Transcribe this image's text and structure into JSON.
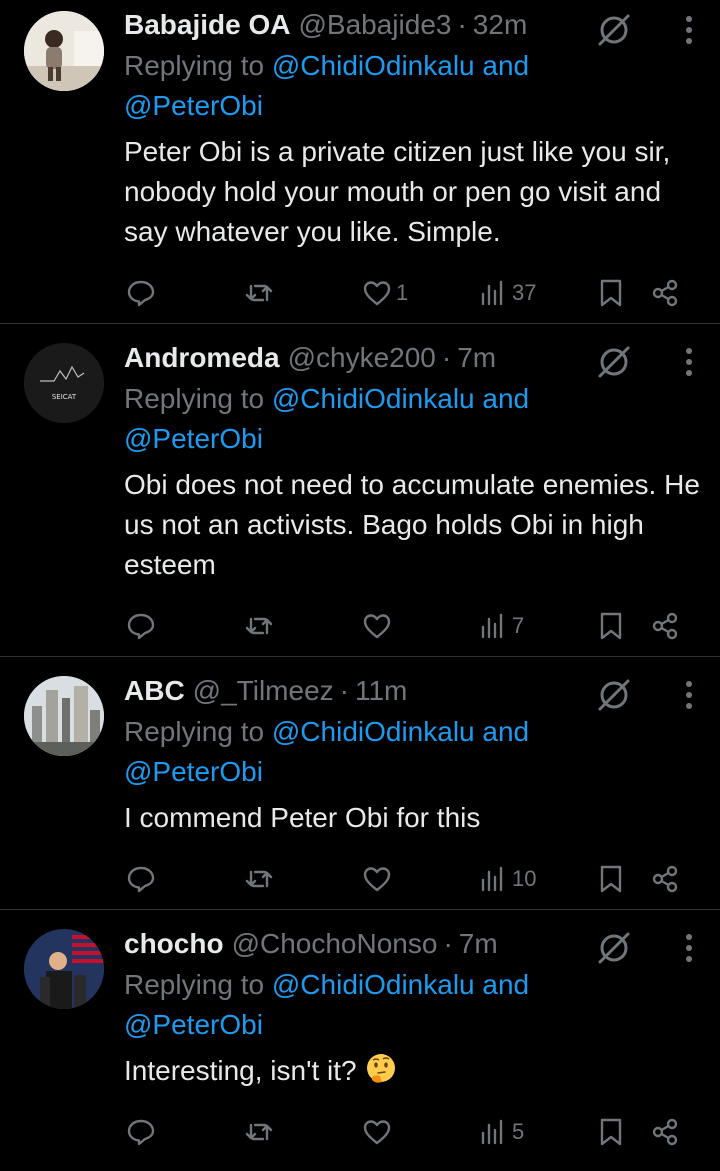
{
  "tweets": [
    {
      "name": "Babajide OA",
      "handle": "@Babajide3",
      "time": "32m",
      "replying_prefix": "Replying to ",
      "replying_mention1": "@ChidiOdinkalu",
      "replying_and": " and",
      "replying_mention2": "@PeterObi",
      "text": "Peter Obi is a private citizen just like you sir, nobody hold your mouth or pen go visit and say whatever you like. Simple.",
      "likes": "1",
      "views": "37",
      "avatar": "photo-child-avatar"
    },
    {
      "name": "Andromeda",
      "handle": "@chyke200",
      "time": "7m",
      "replying_prefix": "Replying to ",
      "replying_mention1": "@ChidiOdinkalu",
      "replying_and": " and",
      "replying_mention2": "@PeterObi",
      "text": "Obi does not need to accumulate enemies. He us not an activists. Bago holds Obi in high esteem",
      "likes": "",
      "views": "7",
      "avatar": "logo-avatar",
      "avatar_text": "SEICAT"
    },
    {
      "name": "ABC",
      "handle": "@_Tilmeez",
      "time": "11m",
      "replying_prefix": "Replying to ",
      "replying_mention1": "@ChidiOdinkalu",
      "replying_and": " and",
      "replying_mention2": "@PeterObi",
      "text": "I commend Peter Obi for this",
      "likes": "",
      "views": "10",
      "avatar": "city-avatar"
    },
    {
      "name": "chocho",
      "handle": "@ChochoNonso",
      "time": "7m",
      "replying_prefix": "Replying to ",
      "replying_mention1": "@ChidiOdinkalu",
      "replying_and": " and",
      "replying_mention2": "@PeterObi",
      "text": "Interesting, isn't it?",
      "emoji": "thinking-face-emoji",
      "likes": "",
      "views": "5",
      "avatar": "flag-avatar"
    }
  ],
  "colors": {
    "background": "#000000",
    "text": "#e7e9ea",
    "muted": "#71767b",
    "mention": "#1d9bf0",
    "divider": "#2f3336"
  }
}
